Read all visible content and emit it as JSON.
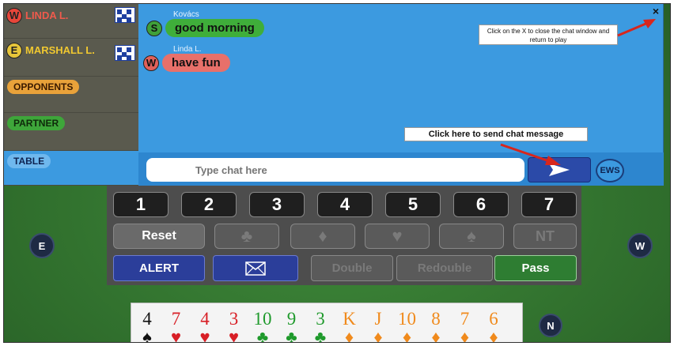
{
  "sidebar": {
    "players": [
      {
        "seat": "W",
        "name": "LINDA L."
      },
      {
        "seat": "E",
        "name": "MARSHALL L."
      }
    ],
    "sections": [
      "OPPONENTS",
      "PARTNER",
      "TABLE"
    ]
  },
  "chat": {
    "messages": [
      {
        "sender": "Kovács",
        "seat": "S",
        "text": "good morning"
      },
      {
        "sender": "Linda L.",
        "seat": "W",
        "text": "have fun"
      }
    ],
    "input_placeholder": "Type chat here",
    "ews_label": "EWS",
    "close_symbol": "×",
    "callout_close": "Click on the X to close the chat window and return to play",
    "callout_send": "Click here to send chat message"
  },
  "bidding": {
    "levels": [
      "1",
      "2",
      "3",
      "4",
      "5",
      "6",
      "7"
    ],
    "reset_label": "Reset",
    "nt_label": "NT",
    "alert_label": "ALERT",
    "double_label": "Double",
    "redouble_label": "Redouble",
    "pass_label": "Pass"
  },
  "seat_markers": {
    "east": "E",
    "west": "W",
    "north": "N"
  },
  "hand": [
    {
      "rank": "4",
      "suit": "♠",
      "color": "#111111"
    },
    {
      "rank": "7",
      "suit": "♥",
      "color": "#d81f26"
    },
    {
      "rank": "4",
      "suit": "♥",
      "color": "#d81f26"
    },
    {
      "rank": "3",
      "suit": "♥",
      "color": "#d81f26"
    },
    {
      "rank": "10",
      "suit": "♣",
      "color": "#1f9a2c"
    },
    {
      "rank": "9",
      "suit": "♣",
      "color": "#1f9a2c"
    },
    {
      "rank": "3",
      "suit": "♣",
      "color": "#1f9a2c"
    },
    {
      "rank": "K",
      "suit": "♦",
      "color": "#f08a1c"
    },
    {
      "rank": "J",
      "suit": "♦",
      "color": "#f08a1c"
    },
    {
      "rank": "10",
      "suit": "♦",
      "color": "#f08a1c"
    },
    {
      "rank": "8",
      "suit": "♦",
      "color": "#f08a1c"
    },
    {
      "rank": "7",
      "suit": "♦",
      "color": "#f08a1c"
    },
    {
      "rank": "6",
      "suit": "♦",
      "color": "#f08a1c"
    }
  ],
  "colors": {
    "chat_bg": "#3c9ae0",
    "felt": "#2f6d2c",
    "send_button": "#2b4aa8",
    "pass_button": "#2e7d32",
    "alert_button": "#2b3e9a",
    "arrow": "#d8261c"
  }
}
